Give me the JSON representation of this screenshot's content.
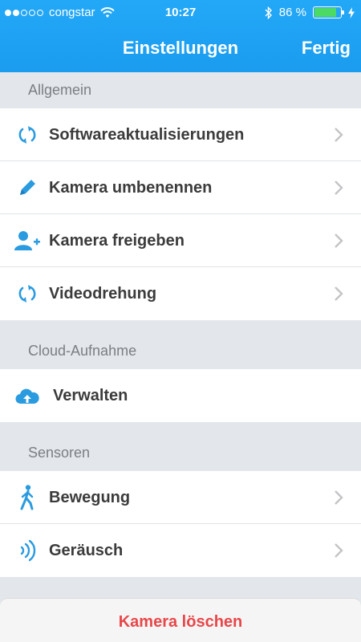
{
  "status_bar": {
    "carrier": "congstar",
    "time": "10:27",
    "battery_text": "86 %",
    "battery_level": 0.86,
    "signal_bars_filled": 2,
    "signal_bars_total": 5,
    "battery_color": "#4cd964"
  },
  "nav": {
    "title": "Einstellungen",
    "done_label": "Fertig",
    "background": "#1da1f2"
  },
  "sections": [
    {
      "header": "Allgemein",
      "items": [
        {
          "label": "Softwareaktualisierungen",
          "icon": "refresh-icon",
          "chevron": true
        },
        {
          "label": "Kamera umbenennen",
          "icon": "pencil-icon",
          "chevron": true
        },
        {
          "label": "Kamera freigeben",
          "icon": "add-user-icon",
          "chevron": true
        },
        {
          "label": "Videodrehung",
          "icon": "refresh-icon",
          "chevron": true
        }
      ]
    },
    {
      "header": "Cloud-Aufnahme",
      "items": [
        {
          "label": "Verwalten",
          "icon": "cloud-upload-icon",
          "chevron": false
        }
      ]
    },
    {
      "header": "Sensoren",
      "items": [
        {
          "label": "Bewegung",
          "icon": "walking-person-icon",
          "chevron": true
        },
        {
          "label": "Geräusch",
          "icon": "sound-waves-icon",
          "chevron": true
        }
      ]
    }
  ],
  "delete_button": {
    "label": "Kamera löschen",
    "color": "#e8474a"
  },
  "colors": {
    "accent": "#2b9be0",
    "section_background": "#e3e6eb",
    "section_text": "#7b7e83"
  }
}
